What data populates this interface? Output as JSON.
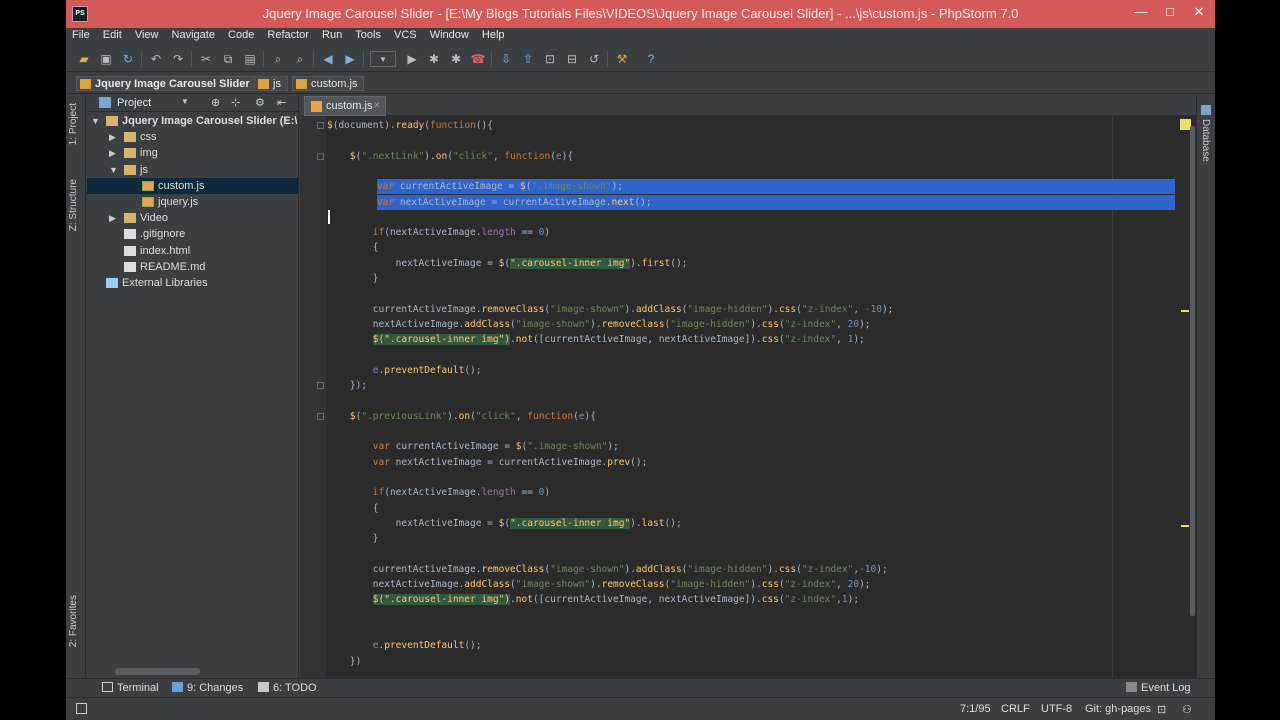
{
  "window": {
    "title": "Jquery Image Carousel Slider - [E:\\My Blogs Tutorials Files\\VIDEOS\\Jquery Image Carousel Slider] - ...\\js\\custom.js - PhpStorm 7.0",
    "app_icon_text": "PS",
    "controls": {
      "minimize": "—",
      "maximize": "□",
      "close": "✕"
    }
  },
  "menu": [
    "File",
    "Edit",
    "View",
    "Navigate",
    "Code",
    "Refactor",
    "Run",
    "Tools",
    "VCS",
    "Window",
    "Help"
  ],
  "breadcrumbs": [
    "Jquery Image Carousel Slider",
    "js",
    "custom.js"
  ],
  "left_tool_tabs": [
    "1: Project",
    "Z: Structure",
    "2: Favorites"
  ],
  "right_tool_tabs": [
    "Database"
  ],
  "project_panel": {
    "title": "Project",
    "tree": [
      {
        "label": "Jquery Image Carousel Slider (E:\\",
        "type": "folder",
        "level": 0,
        "expanded": true
      },
      {
        "label": "css",
        "type": "folder",
        "level": 1,
        "expanded": false
      },
      {
        "label": "img",
        "type": "folder",
        "level": 1,
        "expanded": false
      },
      {
        "label": "js",
        "type": "folder",
        "level": 1,
        "expanded": true
      },
      {
        "label": "custom.js",
        "type": "js",
        "level": 2,
        "selected": true
      },
      {
        "label": "jquery.js",
        "type": "js",
        "level": 2
      },
      {
        "label": "Video",
        "type": "folder",
        "level": 1,
        "expanded": false
      },
      {
        "label": ".gitignore",
        "type": "file",
        "level": 1
      },
      {
        "label": "index.html",
        "type": "file",
        "level": 1
      },
      {
        "label": "README.md",
        "type": "file",
        "level": 1
      },
      {
        "label": "External Libraries",
        "type": "library",
        "level": 0
      }
    ]
  },
  "editor": {
    "active_tab": "custom.js",
    "tab_close": "×",
    "lines": [
      [
        [
          "f",
          "$"
        ],
        [
          "t",
          "(document)."
        ],
        [
          "f",
          "ready"
        ],
        [
          "t",
          "("
        ],
        [
          "k",
          "function"
        ],
        [
          "t",
          "(){"
        ]
      ],
      [],
      [
        [
          "t",
          "    "
        ],
        [
          "f",
          "$"
        ],
        [
          "t",
          "("
        ],
        [
          "s",
          "\".nextLink\""
        ],
        [
          "t",
          ")."
        ],
        [
          "f",
          "on"
        ],
        [
          "t",
          "("
        ],
        [
          "s",
          "\"click\""
        ],
        [
          "t",
          ", "
        ],
        [
          "k",
          "function"
        ],
        [
          "t",
          "("
        ],
        [
          "p",
          "e"
        ],
        [
          "t",
          "){"
        ]
      ],
      [],
      [
        [
          "t",
          "        "
        ],
        [
          "k",
          "var"
        ],
        [
          "t",
          " currentActiveImage = "
        ],
        [
          "f",
          "$"
        ],
        [
          "t",
          "("
        ],
        [
          "s",
          "\".image-shown\""
        ],
        [
          "t",
          ");"
        ]
      ],
      [
        [
          "t",
          "        "
        ],
        [
          "k",
          "var"
        ],
        [
          "t",
          " nextActiveImage = currentActiveImage."
        ],
        [
          "f",
          "next"
        ],
        [
          "t",
          "();"
        ]
      ],
      [],
      [
        [
          "t",
          "        "
        ],
        [
          "k",
          "if"
        ],
        [
          "t",
          "(nextActiveImage."
        ],
        [
          "p",
          "length"
        ],
        [
          "t",
          " == "
        ],
        [
          "n",
          "0"
        ],
        [
          "t",
          ")"
        ]
      ],
      [
        [
          "t",
          "        {"
        ]
      ],
      [
        [
          "t",
          "            nextActiveImage = "
        ],
        [
          "f",
          "$"
        ],
        [
          "t",
          "("
        ],
        [
          "h",
          "\".carousel-inner img\""
        ],
        [
          "t",
          ")."
        ],
        [
          "f",
          "first"
        ],
        [
          "t",
          "();"
        ]
      ],
      [
        [
          "t",
          "        }"
        ]
      ],
      [],
      [
        [
          "t",
          "        currentActiveImage."
        ],
        [
          "f",
          "removeClass"
        ],
        [
          "t",
          "("
        ],
        [
          "s",
          "\"image-shown\""
        ],
        [
          "t",
          ")."
        ],
        [
          "f",
          "addClass"
        ],
        [
          "t",
          "("
        ],
        [
          "s",
          "\"image-hidden\""
        ],
        [
          "t",
          ")."
        ],
        [
          "f",
          "css"
        ],
        [
          "t",
          "("
        ],
        [
          "s",
          "\"z-index\""
        ],
        [
          "t",
          ", "
        ],
        [
          "n",
          "-10"
        ],
        [
          "t",
          ");"
        ]
      ],
      [
        [
          "t",
          "        nextActiveImage."
        ],
        [
          "f",
          "addClass"
        ],
        [
          "t",
          "("
        ],
        [
          "s",
          "\"image-shown\""
        ],
        [
          "t",
          ")."
        ],
        [
          "f",
          "removeClass"
        ],
        [
          "t",
          "("
        ],
        [
          "s",
          "\"image-hidden\""
        ],
        [
          "t",
          ")."
        ],
        [
          "f",
          "css"
        ],
        [
          "t",
          "("
        ],
        [
          "s",
          "\"z-index\""
        ],
        [
          "t",
          ", "
        ],
        [
          "n",
          "20"
        ],
        [
          "t",
          ");"
        ]
      ],
      [
        [
          "t",
          "        "
        ],
        [
          "h",
          "$(\".carousel-inner img\")"
        ],
        [
          "t",
          "."
        ],
        [
          "f",
          "not"
        ],
        [
          "t",
          "([currentActiveImage, nextActiveImage])."
        ],
        [
          "f",
          "css"
        ],
        [
          "t",
          "("
        ],
        [
          "s",
          "\"z-index\""
        ],
        [
          "t",
          ", "
        ],
        [
          "n",
          "1"
        ],
        [
          "t",
          ");"
        ]
      ],
      [],
      [
        [
          "t",
          "        "
        ],
        [
          "p",
          "e"
        ],
        [
          "t",
          "."
        ],
        [
          "f",
          "preventDefault"
        ],
        [
          "t",
          "();"
        ]
      ],
      [
        [
          "t",
          "    });"
        ]
      ],
      [],
      [
        [
          "t",
          "    "
        ],
        [
          "f",
          "$"
        ],
        [
          "t",
          "("
        ],
        [
          "s",
          "\".previousLink\""
        ],
        [
          "t",
          ")."
        ],
        [
          "f",
          "on"
        ],
        [
          "t",
          "("
        ],
        [
          "s",
          "\"click\""
        ],
        [
          "t",
          ", "
        ],
        [
          "k",
          "function"
        ],
        [
          "t",
          "("
        ],
        [
          "p",
          "e"
        ],
        [
          "t",
          "){"
        ]
      ],
      [],
      [
        [
          "t",
          "        "
        ],
        [
          "k",
          "var"
        ],
        [
          "t",
          " currentActiveImage = "
        ],
        [
          "f",
          "$"
        ],
        [
          "t",
          "("
        ],
        [
          "s",
          "\".image-shown\""
        ],
        [
          "t",
          ");"
        ]
      ],
      [
        [
          "t",
          "        "
        ],
        [
          "k",
          "var"
        ],
        [
          "t",
          " nextActiveImage = currentActiveImage."
        ],
        [
          "f",
          "prev"
        ],
        [
          "t",
          "();"
        ]
      ],
      [],
      [
        [
          "t",
          "        "
        ],
        [
          "k",
          "if"
        ],
        [
          "t",
          "(nextActiveImage."
        ],
        [
          "p",
          "length"
        ],
        [
          "t",
          " == "
        ],
        [
          "n",
          "0"
        ],
        [
          "t",
          ")"
        ]
      ],
      [
        [
          "t",
          "        {"
        ]
      ],
      [
        [
          "t",
          "            nextActiveImage = "
        ],
        [
          "f",
          "$"
        ],
        [
          "t",
          "("
        ],
        [
          "h",
          "\".carousel-inner img\""
        ],
        [
          "t",
          ")."
        ],
        [
          "f",
          "last"
        ],
        [
          "t",
          "();"
        ]
      ],
      [
        [
          "t",
          "        }"
        ]
      ],
      [],
      [
        [
          "t",
          "        currentActiveImage."
        ],
        [
          "f",
          "removeClass"
        ],
        [
          "t",
          "("
        ],
        [
          "s",
          "\"image-shown\""
        ],
        [
          "t",
          ")."
        ],
        [
          "f",
          "addClass"
        ],
        [
          "t",
          "("
        ],
        [
          "s",
          "\"image-hidden\""
        ],
        [
          "t",
          ")."
        ],
        [
          "f",
          "css"
        ],
        [
          "t",
          "("
        ],
        [
          "s",
          "\"z-index\""
        ],
        [
          "t",
          ","
        ],
        [
          "n",
          "-10"
        ],
        [
          "t",
          ");"
        ]
      ],
      [
        [
          "t",
          "        nextActiveImage."
        ],
        [
          "f",
          "addClass"
        ],
        [
          "t",
          "("
        ],
        [
          "s",
          "\"image-shown\""
        ],
        [
          "t",
          ")."
        ],
        [
          "f",
          "removeClass"
        ],
        [
          "t",
          "("
        ],
        [
          "s",
          "\"image-hidden\""
        ],
        [
          "t",
          ")."
        ],
        [
          "f",
          "css"
        ],
        [
          "t",
          "("
        ],
        [
          "s",
          "\"z-index\""
        ],
        [
          "t",
          ", "
        ],
        [
          "n",
          "20"
        ],
        [
          "t",
          ");"
        ]
      ],
      [
        [
          "t",
          "        "
        ],
        [
          "h",
          "$(\".carousel-inner img\")"
        ],
        [
          "t",
          "."
        ],
        [
          "f",
          "not"
        ],
        [
          "t",
          "([currentActiveImage, nextActiveImage])."
        ],
        [
          "f",
          "css"
        ],
        [
          "t",
          "("
        ],
        [
          "s",
          "\"z-index\""
        ],
        [
          "t",
          ","
        ],
        [
          "n",
          "1"
        ],
        [
          "t",
          ");"
        ]
      ],
      [],
      [],
      [
        [
          "t",
          "        "
        ],
        [
          "p",
          "e"
        ],
        [
          "t",
          "."
        ],
        [
          "f",
          "preventDefault"
        ],
        [
          "t",
          "();"
        ]
      ],
      [
        [
          "t",
          "    })"
        ]
      ]
    ],
    "selected_lines": [
      4,
      5
    ]
  },
  "bottom_tools": {
    "terminal": "Terminal",
    "changes": "9: Changes",
    "todo": "6: TODO",
    "event_log": "Event Log"
  },
  "status": {
    "position": "7:1/95",
    "line_separator": "CRLF",
    "encoding": "UTF-8",
    "vcs_branch": "Git: gh-pages"
  },
  "colors": {
    "title_bar": "#d45a5a",
    "selection": "#2f65ca",
    "background": "#2b2b2b",
    "keyword": "#cc7832",
    "string": "#6a8759",
    "function": "#ffc66d"
  }
}
